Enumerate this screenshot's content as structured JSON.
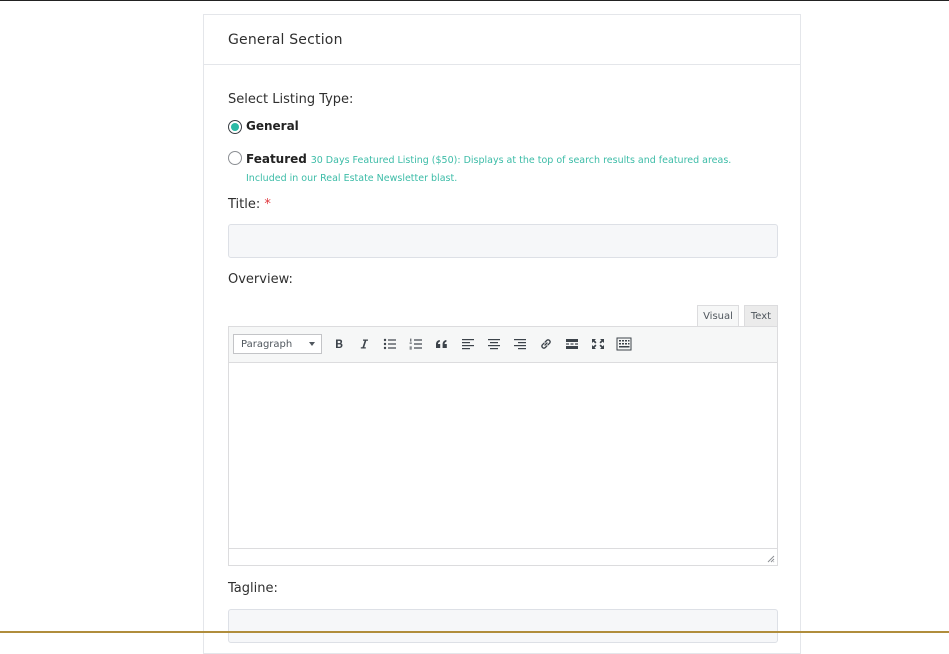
{
  "section": {
    "title": "General Section"
  },
  "listing_type": {
    "label": "Select Listing Type:",
    "options": [
      {
        "label": "General",
        "checked": true
      },
      {
        "label": "Featured",
        "checked": false,
        "description": "30 Days Featured Listing ($50): Displays at the top of search results and featured areas. Included in our Real Estate Newsletter blast."
      }
    ]
  },
  "title_field": {
    "label": "Title:",
    "required_mark": "*",
    "value": ""
  },
  "overview": {
    "label": "Overview:",
    "tabs": [
      "Visual",
      "Text"
    ],
    "active_tab": "Visual",
    "format_select": "Paragraph",
    "toolbar_icons": [
      "bold-icon",
      "italic-icon",
      "bullet-list-icon",
      "numbered-list-icon",
      "blockquote-icon",
      "align-left-icon",
      "align-center-icon",
      "align-right-icon",
      "link-icon",
      "read-more-icon",
      "fullscreen-icon",
      "toolbar-toggle-icon"
    ],
    "content": ""
  },
  "tagline_field": {
    "label": "Tagline:",
    "value": ""
  },
  "colors": {
    "accent": "#2bb9a5",
    "required": "#e0353b",
    "bottom_rule": "#b08d3c"
  }
}
